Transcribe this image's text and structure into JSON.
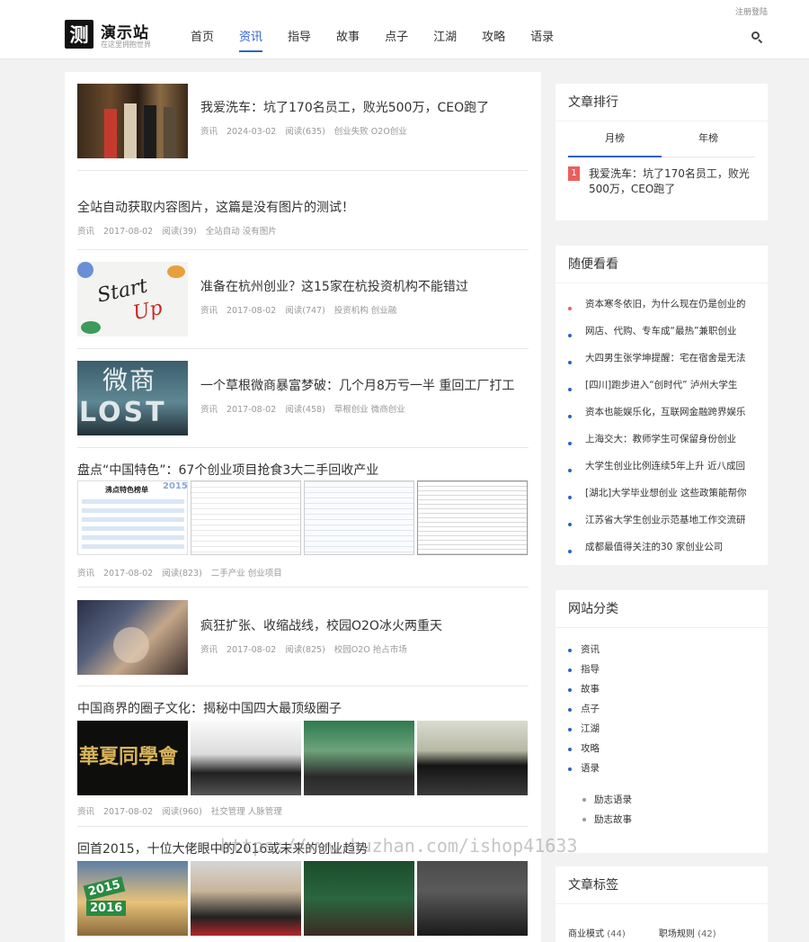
{
  "header": {
    "login_link": "注册登陆",
    "logo_char": "测",
    "logo_title": "演示站",
    "logo_subtitle": "在这里拥抱世界",
    "nav": [
      "首页",
      "资讯",
      "指导",
      "故事",
      "点子",
      "江湖",
      "攻略",
      "语录"
    ],
    "active_nav": "资讯",
    "search_icon": "search-icon"
  },
  "posts": [
    {
      "title": "我爱洗车：坑了170名员工，败光500万，CEO跑了",
      "category": "资讯",
      "date": "2024-03-02",
      "reads": "阅读(635)",
      "tags": "创业失败 O2O创业"
    },
    {
      "title": "全站自动获取内容图片，这篇是没有图片的测试！",
      "category": "资讯",
      "date": "2017-08-02",
      "reads": "阅读(39)",
      "tags": "全站自动 没有图片"
    },
    {
      "title": "准备在杭州创业？这15家在杭投资机构不能错过",
      "category": "资讯",
      "date": "2017-08-02",
      "reads": "阅读(747)",
      "tags": "投资机构 创业融",
      "thumb_text_1": "Start",
      "thumb_text_2": "Up"
    },
    {
      "title": "一个草根微商暴富梦破：几个月8万亏一半 重回工厂打工",
      "category": "资讯",
      "date": "2017-08-02",
      "reads": "阅读(458)",
      "tags": "草根创业 微商创业",
      "thumb_text_1": "微商",
      "thumb_text_2": "LOST"
    },
    {
      "title": "盘点“中国特色”：67个创业项目抢食3大二手回收产业",
      "category": "资讯",
      "date": "2017-08-02",
      "reads": "阅读(823)",
      "tags": "二手产业 创业项目",
      "thumb_text_1": "沸点特色榜单",
      "thumb_text_2": "2015"
    },
    {
      "title": "疯狂扩张、收缩战线，校园O2O冰火两重天",
      "category": "资讯",
      "date": "2017-08-02",
      "reads": "阅读(825)",
      "tags": "校园O2O 抢占市场"
    },
    {
      "title": "中国商界的圈子文化：揭秘中国四大最顶级圈子",
      "category": "资讯",
      "date": "2017-08-02",
      "reads": "阅读(960)",
      "tags": "社交管理 人脉管理",
      "thumb_text_1": "華夏同學會"
    },
    {
      "title": "回首2015，十位大佬眼中的2016或未来的创业趋势",
      "thumb_text_1": "2015",
      "thumb_text_2": "2016"
    }
  ],
  "sidebar": {
    "ranking": {
      "title": "文章排行",
      "tabs": [
        "月榜",
        "年榜"
      ],
      "active_tab": "月榜",
      "items": [
        {
          "rank": "1",
          "title": "我爱洗车：坑了170名员工，败光500万，CEO跑了"
        }
      ]
    },
    "random": {
      "title": "随便看看",
      "items": [
        "资本寒冬依旧，为什么现在仍是创业的",
        "网店、代购、专车成“最热”兼职创业",
        "大四男生张学坤提醒：宅在宿舍是无法",
        "[四川]跑步进入“创时代” 泸州大学生",
        "资本也能娱乐化，互联网金融跨界娱乐",
        "上海交大：教师学生可保留身份创业",
        "大学生创业比例连续5年上升 近八成回",
        "[湖北]大学毕业想创业 这些政策能帮你",
        "江苏省大学生创业示范基地工作交流研",
        "成都最值得关注的30 家创业公司"
      ]
    },
    "categories": {
      "title": "网站分类",
      "items": [
        "资讯",
        "指导",
        "故事",
        "点子",
        "江湖",
        "攻略",
        "语录"
      ],
      "sub_items": [
        "励志语录",
        "励志故事"
      ]
    },
    "tags": {
      "title": "文章标签",
      "items": [
        {
          "name": "商业模式",
          "count": "(44)"
        },
        {
          "name": "职场规则",
          "count": "(42)"
        }
      ]
    }
  },
  "watermark": "https://www.huzhan.com/ishop41633"
}
